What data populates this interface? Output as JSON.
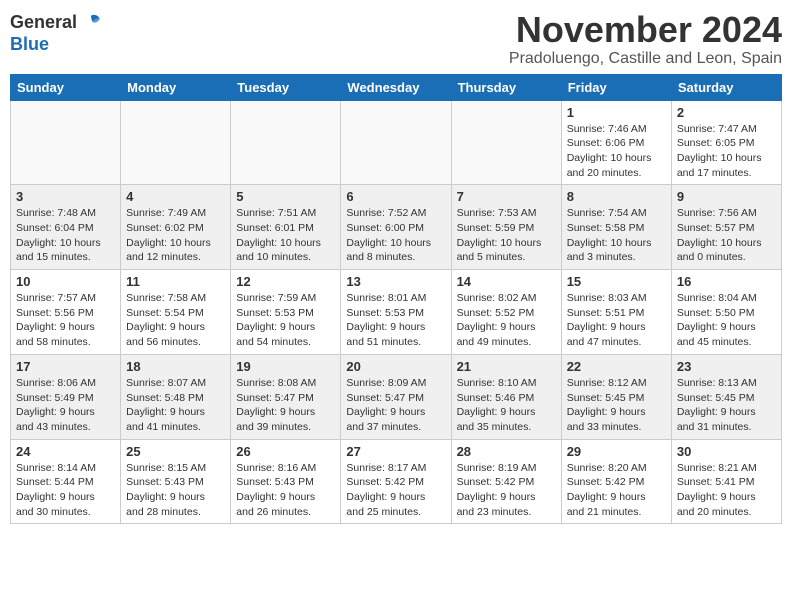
{
  "header": {
    "logo_general": "General",
    "logo_blue": "Blue",
    "month_title": "November 2024",
    "location": "Pradoluengo, Castille and Leon, Spain"
  },
  "weekdays": [
    "Sunday",
    "Monday",
    "Tuesday",
    "Wednesday",
    "Thursday",
    "Friday",
    "Saturday"
  ],
  "weeks": [
    [
      {
        "day": "",
        "info": ""
      },
      {
        "day": "",
        "info": ""
      },
      {
        "day": "",
        "info": ""
      },
      {
        "day": "",
        "info": ""
      },
      {
        "day": "",
        "info": ""
      },
      {
        "day": "1",
        "info": "Sunrise: 7:46 AM\nSunset: 6:06 PM\nDaylight: 10 hours and 20 minutes."
      },
      {
        "day": "2",
        "info": "Sunrise: 7:47 AM\nSunset: 6:05 PM\nDaylight: 10 hours and 17 minutes."
      }
    ],
    [
      {
        "day": "3",
        "info": "Sunrise: 7:48 AM\nSunset: 6:04 PM\nDaylight: 10 hours and 15 minutes."
      },
      {
        "day": "4",
        "info": "Sunrise: 7:49 AM\nSunset: 6:02 PM\nDaylight: 10 hours and 12 minutes."
      },
      {
        "day": "5",
        "info": "Sunrise: 7:51 AM\nSunset: 6:01 PM\nDaylight: 10 hours and 10 minutes."
      },
      {
        "day": "6",
        "info": "Sunrise: 7:52 AM\nSunset: 6:00 PM\nDaylight: 10 hours and 8 minutes."
      },
      {
        "day": "7",
        "info": "Sunrise: 7:53 AM\nSunset: 5:59 PM\nDaylight: 10 hours and 5 minutes."
      },
      {
        "day": "8",
        "info": "Sunrise: 7:54 AM\nSunset: 5:58 PM\nDaylight: 10 hours and 3 minutes."
      },
      {
        "day": "9",
        "info": "Sunrise: 7:56 AM\nSunset: 5:57 PM\nDaylight: 10 hours and 0 minutes."
      }
    ],
    [
      {
        "day": "10",
        "info": "Sunrise: 7:57 AM\nSunset: 5:56 PM\nDaylight: 9 hours and 58 minutes."
      },
      {
        "day": "11",
        "info": "Sunrise: 7:58 AM\nSunset: 5:54 PM\nDaylight: 9 hours and 56 minutes."
      },
      {
        "day": "12",
        "info": "Sunrise: 7:59 AM\nSunset: 5:53 PM\nDaylight: 9 hours and 54 minutes."
      },
      {
        "day": "13",
        "info": "Sunrise: 8:01 AM\nSunset: 5:53 PM\nDaylight: 9 hours and 51 minutes."
      },
      {
        "day": "14",
        "info": "Sunrise: 8:02 AM\nSunset: 5:52 PM\nDaylight: 9 hours and 49 minutes."
      },
      {
        "day": "15",
        "info": "Sunrise: 8:03 AM\nSunset: 5:51 PM\nDaylight: 9 hours and 47 minutes."
      },
      {
        "day": "16",
        "info": "Sunrise: 8:04 AM\nSunset: 5:50 PM\nDaylight: 9 hours and 45 minutes."
      }
    ],
    [
      {
        "day": "17",
        "info": "Sunrise: 8:06 AM\nSunset: 5:49 PM\nDaylight: 9 hours and 43 minutes."
      },
      {
        "day": "18",
        "info": "Sunrise: 8:07 AM\nSunset: 5:48 PM\nDaylight: 9 hours and 41 minutes."
      },
      {
        "day": "19",
        "info": "Sunrise: 8:08 AM\nSunset: 5:47 PM\nDaylight: 9 hours and 39 minutes."
      },
      {
        "day": "20",
        "info": "Sunrise: 8:09 AM\nSunset: 5:47 PM\nDaylight: 9 hours and 37 minutes."
      },
      {
        "day": "21",
        "info": "Sunrise: 8:10 AM\nSunset: 5:46 PM\nDaylight: 9 hours and 35 minutes."
      },
      {
        "day": "22",
        "info": "Sunrise: 8:12 AM\nSunset: 5:45 PM\nDaylight: 9 hours and 33 minutes."
      },
      {
        "day": "23",
        "info": "Sunrise: 8:13 AM\nSunset: 5:45 PM\nDaylight: 9 hours and 31 minutes."
      }
    ],
    [
      {
        "day": "24",
        "info": "Sunrise: 8:14 AM\nSunset: 5:44 PM\nDaylight: 9 hours and 30 minutes."
      },
      {
        "day": "25",
        "info": "Sunrise: 8:15 AM\nSunset: 5:43 PM\nDaylight: 9 hours and 28 minutes."
      },
      {
        "day": "26",
        "info": "Sunrise: 8:16 AM\nSunset: 5:43 PM\nDaylight: 9 hours and 26 minutes."
      },
      {
        "day": "27",
        "info": "Sunrise: 8:17 AM\nSunset: 5:42 PM\nDaylight: 9 hours and 25 minutes."
      },
      {
        "day": "28",
        "info": "Sunrise: 8:19 AM\nSunset: 5:42 PM\nDaylight: 9 hours and 23 minutes."
      },
      {
        "day": "29",
        "info": "Sunrise: 8:20 AM\nSunset: 5:42 PM\nDaylight: 9 hours and 21 minutes."
      },
      {
        "day": "30",
        "info": "Sunrise: 8:21 AM\nSunset: 5:41 PM\nDaylight: 9 hours and 20 minutes."
      }
    ]
  ]
}
